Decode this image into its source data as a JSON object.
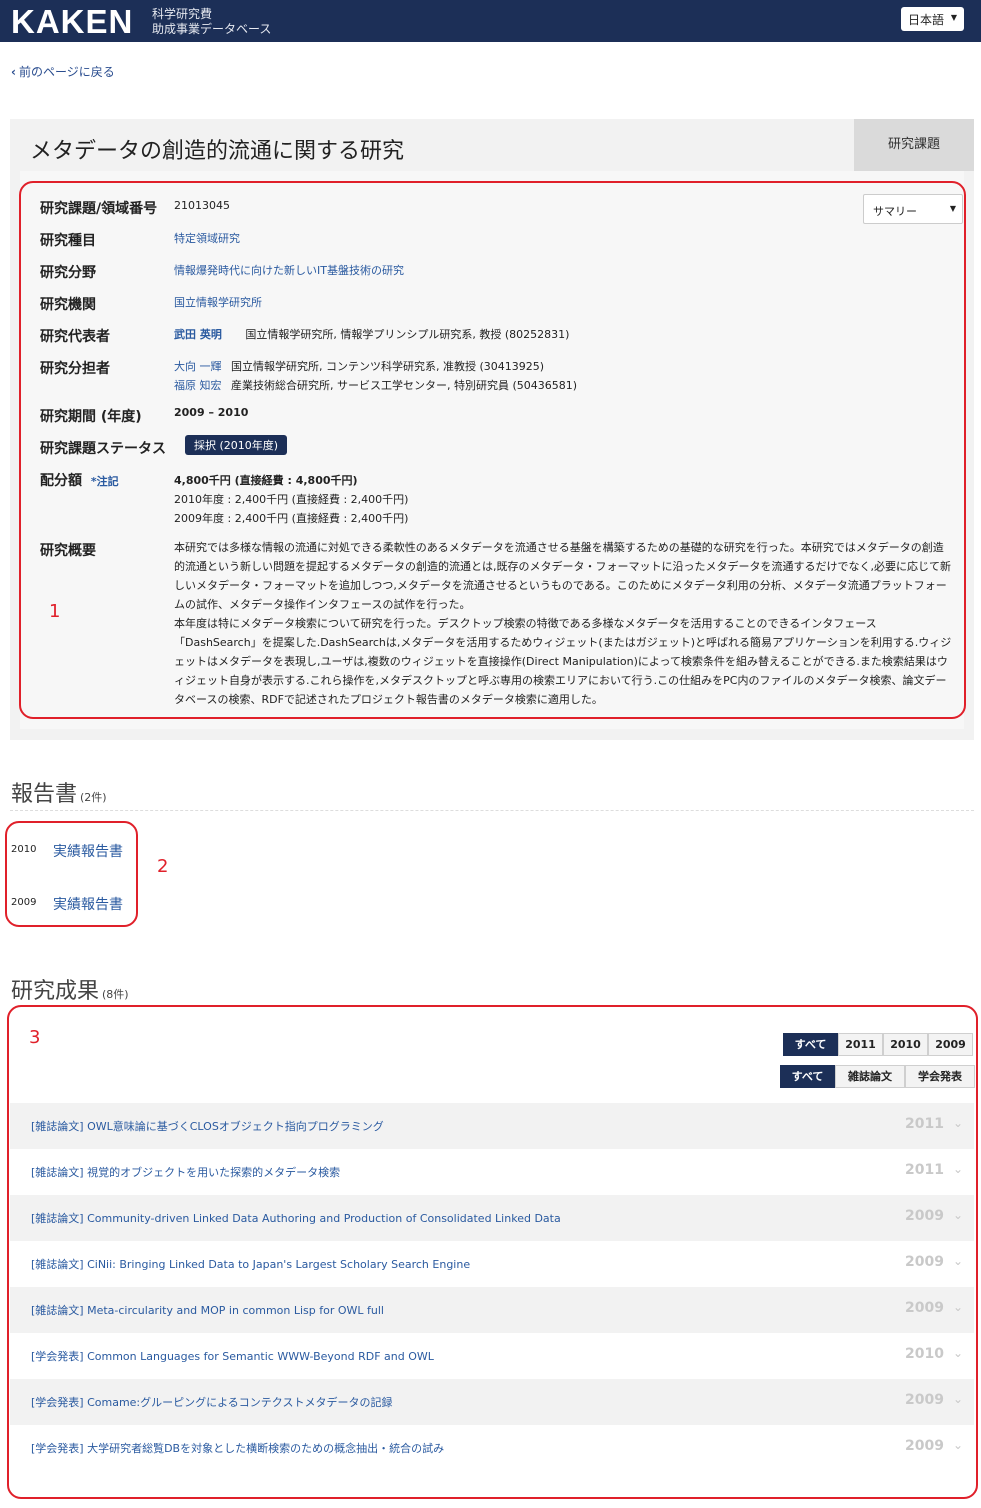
{
  "header": {
    "logo": "KAKEN",
    "subtitle_line1": "科学研究費",
    "subtitle_line2": "助成事業データベース",
    "language": "日本語"
  },
  "nav": {
    "back_label": "前のページに戻る"
  },
  "project": {
    "title": "メタデータの創造的流通に関する研究",
    "type_tag": "研究課題",
    "view_select": "サマリー",
    "fields": {
      "number_label": "研究課題/領域番号",
      "number_value": "21013045",
      "category_label": "研究種目",
      "category_value": "特定領域研究",
      "area_label": "研究分野",
      "area_value": "情報爆発時代に向けた新しいIT基盤技術の研究",
      "institution_label": "研究機関",
      "institution_value": "国立情報学研究所",
      "pi_label": "研究代表者",
      "pi_name": "武田 英明",
      "pi_affil": "国立情報学研究所, 情報学プリンシプル研究系, 教授 (80252831)",
      "co_label": "研究分担者",
      "co1_name": "大向 一輝",
      "co1_affil": "国立情報学研究所, コンテンツ科学研究系, 准教授 (30413925)",
      "co2_name": "福原 知宏",
      "co2_affil": "産業技術総合研究所, サービス工学センター, 特別研究員 (50436581)",
      "period_label": "研究期間 (年度)",
      "period_value": "2009 – 2010",
      "status_label": "研究課題ステータス",
      "status_value": "採択 (2010年度)",
      "budget_label": "配分額",
      "budget_note": "*注記",
      "budget_total": "4,800千円 (直接経費 : 4,800千円)",
      "budget_2010": "2010年度 : 2,400千円 (直接経費 : 2,400千円)",
      "budget_2009": "2009年度 : 2,400千円 (直接経費 : 2,400千円)",
      "abstract_label": "研究概要",
      "abstract_p1": "本研究では多様な情報の流通に対処できる柔軟性のあるメタデータを流通させる基盤を構築するための基礎的な研究を行った。本研究ではメタデータの創造的流通という新しい問題を提起するメタデータの創造的流通とは,既存のメタデータ・フォーマットに沿ったメタデータを流通するだけでなく,必要に応じて新しいメタデータ・フォーマットを追加しつつ,メタデータを流通させるというものである。このためにメタデータ利用の分析、メタデータ流通プラットフォームの試作、メタデータ操作インタフェースの試作を行った。",
      "abstract_p2": "本年度は特にメタデータ検索について研究を行った。デスクトップ検索の特徴である多様なメタデータを活用することのできるインタフェース「DashSearch」を提案した.DashSearchは,メタデータを活用するためウィジェット(またはガジェット)と呼ばれる簡易アプリケーションを利用する.ウィジェットはメタデータを表現し,ユーザは,複数のウィジェットを直接操作(Direct Manipulation)によって検索条件を組み替えることができる.また検索結果はウィジェット自身が表示する.これら操作を,メタデスクトップと呼ぶ専用の検索エリアにおいて行う.この仕組みをPC内のファイルのメタデータ検索、論文データベースの検索、RDFで記述されたプロジェクト報告書のメタデータ検索に適用した。"
    }
  },
  "annotations": {
    "box1": "1",
    "box2": "2",
    "box3": "3"
  },
  "reports": {
    "title": "報告書",
    "count": "(2件)",
    "items": [
      {
        "year": "2010",
        "label": "実績報告書"
      },
      {
        "year": "2009",
        "label": "実績報告書"
      }
    ]
  },
  "outputs": {
    "title": "研究成果",
    "count": "(8件)",
    "year_filters": [
      "すべて",
      "2011",
      "2010",
      "2009"
    ],
    "type_filters": [
      "すべて",
      "雑誌論文",
      "学会発表"
    ],
    "items": [
      {
        "title": "[雑誌論文] OWL意味論に基づくCLOSオブジェクト指向プログラミング",
        "year": "2011"
      },
      {
        "title": "[雑誌論文] 視覚的オブジェクトを用いた探索的メタデータ検索",
        "year": "2011"
      },
      {
        "title": "[雑誌論文] Community-driven Linked Data Authoring and Production of Consolidated Linked Data",
        "year": "2009"
      },
      {
        "title": "[雑誌論文] CiNii: Bringing Linked Data to Japan's Largest Scholary Search Engine",
        "year": "2009"
      },
      {
        "title": "[雑誌論文] Meta-circularity and MOP in common Lisp for OWL full",
        "year": "2009"
      },
      {
        "title": "[学会発表] Common Languages for Semantic WWW-Beyond RDF and OWL",
        "year": "2010"
      },
      {
        "title": "[学会発表] Comame:グルーピングによるコンテクストメタデータの記録",
        "year": "2009"
      },
      {
        "title": "[学会発表] 大学研究者総覧DBを対象とした横断検索のための概念抽出・統合の試み",
        "year": "2009"
      }
    ]
  },
  "colors": {
    "navy": "#1c2f57",
    "link": "#2a5aa0",
    "annotation_red": "#e0202a"
  }
}
